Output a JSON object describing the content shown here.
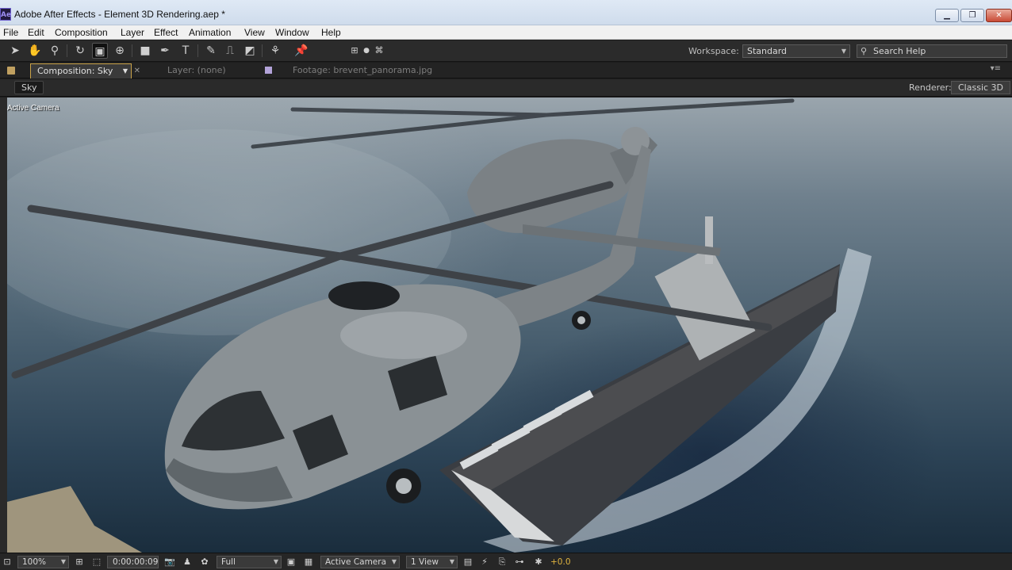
{
  "window": {
    "app_icon": "Ae",
    "title": "Adobe After Effects - Element 3D Rendering.aep *"
  },
  "menu": [
    "File",
    "Edit",
    "Composition",
    "Layer",
    "Effect",
    "Animation",
    "View",
    "Window",
    "Help"
  ],
  "tools": [
    "selection-tool-icon",
    "hand-tool-icon",
    "zoom-tool-icon",
    "rotation-tool-icon",
    "camera-tool-icon",
    "pan-behind-tool-icon",
    "rectangle-tool-icon",
    "pen-tool-icon",
    "type-tool-icon",
    "brush-tool-icon",
    "clone-stamp-tool-icon",
    "eraser-tool-icon",
    "roto-brush-tool-icon",
    "puppet-pin-tool-icon"
  ],
  "workspace": {
    "label": "Workspace:",
    "value": "Standard"
  },
  "search": {
    "placeholder": "Search Help"
  },
  "tabs": {
    "composition": "Composition: Sky",
    "layer": "Layer: (none)",
    "footage": "Footage: brevent_panorama.jpg"
  },
  "breadcrumb": "Sky",
  "renderer": {
    "label": "Renderer:",
    "value": "Classic 3D"
  },
  "viewer": {
    "camera_label": "Active Camera"
  },
  "controls": {
    "zoom": "100%",
    "timecode": "0:00:00:09",
    "resolution": "Full",
    "camera": "Active Camera",
    "views": "1 View",
    "exposure": "+0.0"
  },
  "colors": {
    "active_tab_outline": "#c9a248",
    "exposure_text": "#e0b440",
    "app_icon_bg": "#221b3f"
  }
}
